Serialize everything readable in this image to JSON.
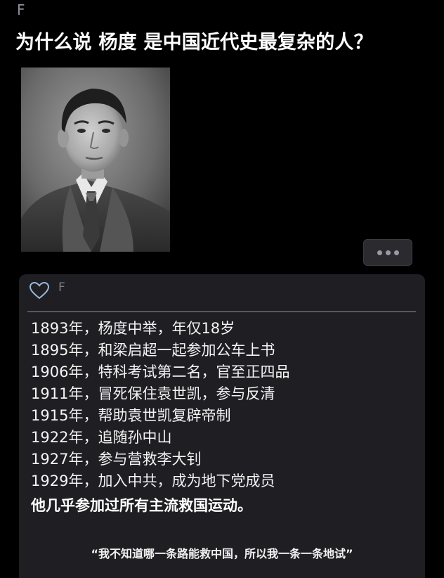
{
  "top_letter": "F",
  "headline": "为什么说 杨度 是中国近代史最复杂的人？",
  "portrait_icon": "portrait-photo",
  "more_button_icon": "ellipsis-icon",
  "card": {
    "avatar_icon": "heart-outline-icon",
    "letter": "F",
    "timeline": [
      "1893年，杨度中举，年仅18岁",
      "1895年，和梁启超一起参加公车上书",
      "1906年，特科考试第二名，官至正四品",
      "1911年，冒死保住袁世凯，参与反清",
      "1915年，帮助袁世凯复辟帝制",
      "1922年，追随孙中山",
      "1927年，参与营救李大钊",
      "1929年，加入中共，成为地下党成员"
    ],
    "summary": "他几乎参加过所有主流救国运动。",
    "quote": "“我不知道哪一条路能救中国，所以我一条一条地试”"
  },
  "colors": {
    "background": "#000000",
    "card": "#1e1e23",
    "accent_heart": "#9db8d6"
  }
}
